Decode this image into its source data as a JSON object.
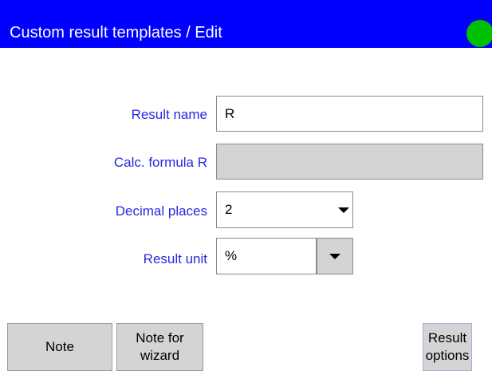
{
  "window": {
    "title": "Custom result templates / Edit",
    "status_color": "#00c000",
    "title_bar_color": "#0000ff"
  },
  "form": {
    "label_color": "#2828e0",
    "result_name": {
      "label": "Result name",
      "value": "R"
    },
    "calc_formula": {
      "label": "Calc. formula R",
      "value": ""
    },
    "decimal_places": {
      "label": "Decimal places",
      "value": "2"
    },
    "result_unit": {
      "label": "Result unit",
      "value": "%"
    }
  },
  "buttons": {
    "note": "Note",
    "note_for_wizard_line1": "Note for",
    "note_for_wizard_line2": "wizard",
    "result_options_line1": "Result",
    "result_options_line2": "options"
  }
}
